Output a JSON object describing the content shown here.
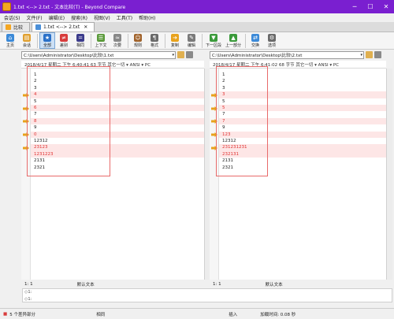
{
  "window": {
    "title": "1.txt <--> 2.txt - 文本比较(T) - Beyond Compare"
  },
  "menu": [
    "会话(S)",
    "文件(F)",
    "编辑(E)",
    "搜索(R)",
    "视图(V)",
    "工具(T)",
    "帮助(H)"
  ],
  "tabs": [
    {
      "label": "比较",
      "icon_color": "#f4a621"
    },
    {
      "label": "1.txt <--> 2.txt",
      "icon_color": "#4a8fd8"
    }
  ],
  "toolbar": {
    "home": "主页",
    "session": "会话",
    "all": "全部",
    "diffs": "差别",
    "same": "相同",
    "context": "上下文",
    "minor": "次要",
    "rules": "规则",
    "format": "格式",
    "copy": "复制",
    "edit": "编辑",
    "next_section": "下一区段",
    "prev_section": "上一部分",
    "swap": "交换",
    "options": "选项"
  },
  "left": {
    "path": "C:\\Users\\Administrator\\Desktop\\比较\\1.txt",
    "info": "2018/4/17 星期二 下午 6:40:41    63 字节    其它一切 ▾  ANSI ▾  PC",
    "lines": [
      {
        "text": "1",
        "diff": false,
        "arrow": false
      },
      {
        "text": "2",
        "diff": false,
        "arrow": false
      },
      {
        "text": "3",
        "diff": false,
        "arrow": false
      },
      {
        "text": "4",
        "diff": true,
        "arrow": true
      },
      {
        "text": "5",
        "diff": false,
        "arrow": false
      },
      {
        "text": "6",
        "diff": true,
        "arrow": true
      },
      {
        "text": "7",
        "diff": false,
        "arrow": false
      },
      {
        "text": "8",
        "diff": true,
        "arrow": true
      },
      {
        "text": "9",
        "diff": false,
        "arrow": false
      },
      {
        "text": "0",
        "diff": true,
        "arrow": true
      },
      {
        "text": "12312",
        "diff": false,
        "arrow": false
      },
      {
        "text": "23123",
        "diff": true,
        "arrow": true
      },
      {
        "text": "1231223",
        "diff": true,
        "arrow": false
      },
      {
        "text": "2131",
        "diff": false,
        "arrow": false
      },
      {
        "text": "2321",
        "diff": false,
        "arrow": false
      }
    ],
    "position": "1: 1",
    "encoding_label": "默认文本"
  },
  "right": {
    "path": "C:\\Users\\Administrator\\Desktop\\比较\\2.txt",
    "info": "2018/4/17 星期二 下午 6:41:02    68 字节    其它一切 ▾  ANSI ▾  PC",
    "lines": [
      {
        "text": "1",
        "diff": false,
        "arrow": false
      },
      {
        "text": "2",
        "diff": false,
        "arrow": false
      },
      {
        "text": "3",
        "diff": false,
        "arrow": false
      },
      {
        "text": "3",
        "diff": true,
        "arrow": true
      },
      {
        "text": "5",
        "diff": false,
        "arrow": false
      },
      {
        "text": "5",
        "diff": true,
        "arrow": true
      },
      {
        "text": "7",
        "diff": false,
        "arrow": false
      },
      {
        "text": "7",
        "diff": true,
        "arrow": true
      },
      {
        "text": "9",
        "diff": false,
        "arrow": false
      },
      {
        "text": "123",
        "diff": true,
        "arrow": true
      },
      {
        "text": "12312",
        "diff": false,
        "arrow": false
      },
      {
        "text": "231231231",
        "diff": true,
        "arrow": true
      },
      {
        "text": "232131",
        "diff": true,
        "arrow": false
      },
      {
        "text": "2131",
        "diff": false,
        "arrow": false
      },
      {
        "text": "2321",
        "diff": false,
        "arrow": false
      }
    ],
    "position": "1: 1",
    "encoding_label": "默认文本"
  },
  "detail": {
    "line1": "◇1:",
    "line2": "◇1:"
  },
  "status": {
    "diff_count": "5 个差异部分",
    "same": "相同",
    "mode": "插入",
    "load_time": "加载时间: 0.08 秒"
  },
  "colors": {
    "title_bg": "#7a1fd0",
    "diff_bg": "#fde6e6",
    "diff_text": "#e03030",
    "arrow": "#e8a21c"
  }
}
